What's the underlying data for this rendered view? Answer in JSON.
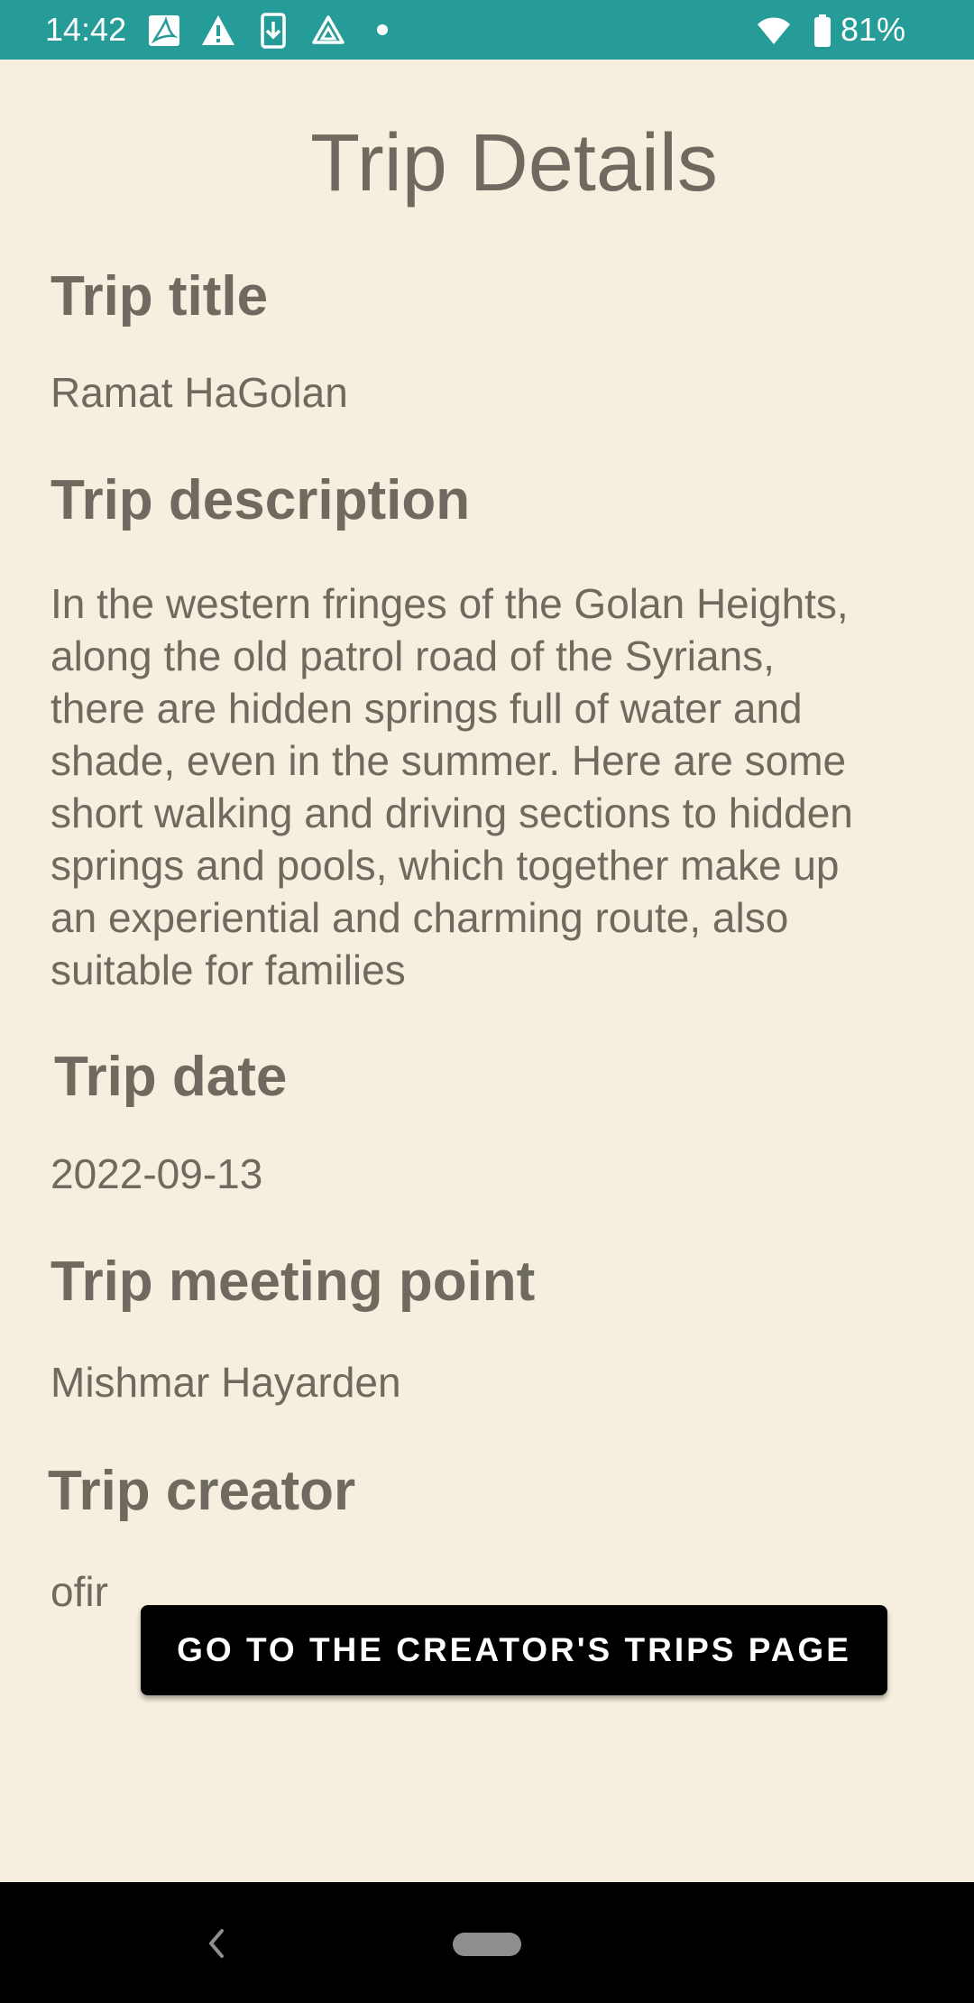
{
  "status_bar": {
    "time": "14:42",
    "battery_percent": "81%",
    "background_color": "#259c97",
    "notification_icons": [
      "pdf-icon",
      "warning-icon",
      "download-icon",
      "drive-icon"
    ],
    "system_icons": [
      "wifi-icon",
      "battery-icon"
    ]
  },
  "page": {
    "title": "Trip Details",
    "background_color": "#f6efdf",
    "text_color": "#6f6a5f"
  },
  "trip": {
    "title_label": "Trip title",
    "title_value": "Ramat HaGolan",
    "description_label": "Trip description",
    "description_lines": [
      "In the western fringes of the Golan Heights,",
      "along the old patrol road of the Syrians,",
      "there are hidden springs full of water and",
      "shade, even in the summer. Here are some",
      "short walking and driving sections to hidden",
      "springs and pools, which together make up",
      "an experiential and charming route, also",
      "suitable for families"
    ],
    "date_label": "Trip date",
    "date_value": "2022-09-13",
    "meeting_point_label": "Trip meeting point",
    "meeting_point_value": "Mishmar Hayarden",
    "creator_label": "Trip creator",
    "creator_value": "ofir"
  },
  "actions": {
    "creator_trips_button_label": "GO TO THE CREATOR'S TRIPS PAGE"
  },
  "nav_bar": {
    "icons": [
      "back-icon",
      "home-pill-icon"
    ]
  }
}
